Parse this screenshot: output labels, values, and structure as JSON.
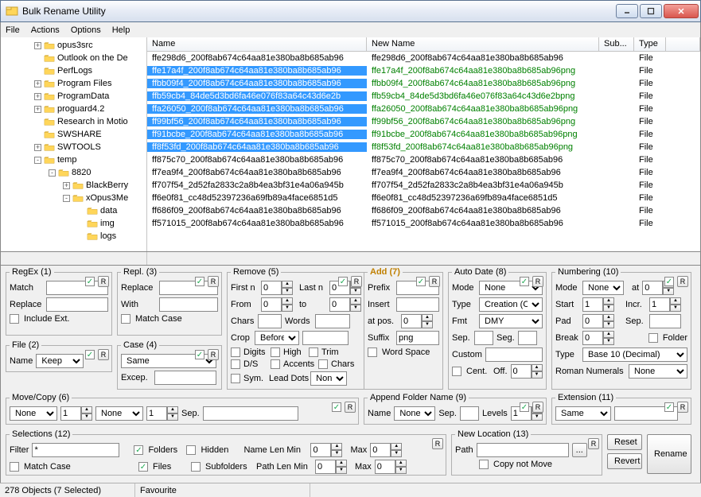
{
  "window": {
    "title": "Bulk Rename Utility"
  },
  "menu": {
    "file": "File",
    "actions": "Actions",
    "options": "Options",
    "help": "Help"
  },
  "tree": [
    {
      "indent": 42,
      "pm": "+",
      "label": "opus3src"
    },
    {
      "indent": 42,
      "pm": "",
      "label": "Outlook on the De"
    },
    {
      "indent": 42,
      "pm": "",
      "label": "PerfLogs"
    },
    {
      "indent": 42,
      "pm": "+",
      "label": "Program Files"
    },
    {
      "indent": 42,
      "pm": "+",
      "label": "ProgramData"
    },
    {
      "indent": 42,
      "pm": "+",
      "label": "proguard4.2"
    },
    {
      "indent": 42,
      "pm": "",
      "label": "Research in Motio"
    },
    {
      "indent": 42,
      "pm": "",
      "label": "SWSHARE"
    },
    {
      "indent": 42,
      "pm": "+",
      "label": "SWTOOLS"
    },
    {
      "indent": 42,
      "pm": "-",
      "label": "temp"
    },
    {
      "indent": 60,
      "pm": "-",
      "label": "8820"
    },
    {
      "indent": 78,
      "pm": "+",
      "label": "BlackBerry"
    },
    {
      "indent": 78,
      "pm": "-",
      "label": "xOpus3Me"
    },
    {
      "indent": 96,
      "pm": "",
      "label": "data"
    },
    {
      "indent": 96,
      "pm": "",
      "label": "img"
    },
    {
      "indent": 96,
      "pm": "",
      "label": "logs"
    }
  ],
  "columns": {
    "name": "Name",
    "newname": "New Name",
    "sub": "Sub...",
    "type": "Type"
  },
  "files": [
    {
      "sel": false,
      "name": "ffe298d6_200f8ab674c64aa81e380ba8b685ab96",
      "newname": "ffe298d6_200f8ab674c64aa81e380ba8b685ab96",
      "green": false,
      "type": "File"
    },
    {
      "sel": true,
      "name": "ffe17a4f_200f8ab674c64aa81e380ba8b685ab96",
      "newname": "ffe17a4f_200f8ab674c64aa81e380ba8b685ab96png",
      "green": true,
      "type": "File"
    },
    {
      "sel": true,
      "name": "ffbb09f4_200f8ab674c64aa81e380ba8b685ab96",
      "newname": "ffbb09f4_200f8ab674c64aa81e380ba8b685ab96png",
      "green": true,
      "type": "File"
    },
    {
      "sel": true,
      "name": "ffb59cb4_84de5d3bd6fa46e076f83a64c43d6e2b",
      "newname": "ffb59cb4_84de5d3bd6fa46e076f83a64c43d6e2bpng",
      "green": true,
      "type": "File"
    },
    {
      "sel": true,
      "name": "ffa26050_200f8ab674c64aa81e380ba8b685ab96",
      "newname": "ffa26050_200f8ab674c64aa81e380ba8b685ab96png",
      "green": true,
      "type": "File"
    },
    {
      "sel": true,
      "name": "ff99bf56_200f8ab674c64aa81e380ba8b685ab96",
      "newname": "ff99bf56_200f8ab674c64aa81e380ba8b685ab96png",
      "green": true,
      "type": "File"
    },
    {
      "sel": true,
      "name": "ff91bcbe_200f8ab674c64aa81e380ba8b685ab96",
      "newname": "ff91bcbe_200f8ab674c64aa81e380ba8b685ab96png",
      "green": true,
      "type": "File"
    },
    {
      "sel": true,
      "name": "ff8f53fd_200f8ab674c64aa81e380ba8b685ab96",
      "newname": "ff8f53fd_200f8ab674c64aa81e380ba8b685ab96png",
      "green": true,
      "type": "File"
    },
    {
      "sel": false,
      "name": "ff875c70_200f8ab674c64aa81e380ba8b685ab96",
      "newname": "ff875c70_200f8ab674c64aa81e380ba8b685ab96",
      "green": false,
      "type": "File"
    },
    {
      "sel": false,
      "name": "ff7ea9f4_200f8ab674c64aa81e380ba8b685ab96",
      "newname": "ff7ea9f4_200f8ab674c64aa81e380ba8b685ab96",
      "green": false,
      "type": "File"
    },
    {
      "sel": false,
      "name": "ff707f54_2d52fa2833c2a8b4ea3bf31e4a06a945b",
      "newname": "ff707f54_2d52fa2833c2a8b4ea3bf31e4a06a945b",
      "green": false,
      "type": "File"
    },
    {
      "sel": false,
      "name": "ff6e0f81_cc48d52397236a69fb89a4face6851d5",
      "newname": "ff6e0f81_cc48d52397236a69fb89a4face6851d5",
      "green": false,
      "type": "File"
    },
    {
      "sel": false,
      "name": "ff686f09_200f8ab674c64aa81e380ba8b685ab96",
      "newname": "ff686f09_200f8ab674c64aa81e380ba8b685ab96",
      "green": false,
      "type": "File"
    },
    {
      "sel": false,
      "name": "ff571015_200f8ab674c64aa81e380ba8b685ab96",
      "newname": "ff571015_200f8ab674c64aa81e380ba8b685ab96",
      "green": false,
      "type": "File"
    }
  ],
  "regex": {
    "legend": "RegEx (1)",
    "match": "Match",
    "replace": "Replace",
    "include": "Include Ext."
  },
  "repl": {
    "legend": "Repl. (3)",
    "replace": "Replace",
    "with": "With",
    "matchcase": "Match Case"
  },
  "file": {
    "legend": "File (2)",
    "name": "Name",
    "keep": "Keep"
  },
  "case": {
    "legend": "Case (4)",
    "same": "Same",
    "excep": "Excep."
  },
  "remove": {
    "legend": "Remove (5)",
    "firstn": "First n",
    "lastn": "Last n",
    "from": "From",
    "to": "to",
    "chars": "Chars",
    "words": "Words",
    "crop": "Crop",
    "before": "Before",
    "digits": "Digits",
    "high": "High",
    "trim": "Trim",
    "ds": "D/S",
    "accents": "Accents",
    "chars2": "Chars",
    "sym": "Sym.",
    "lead": "Lead Dots",
    "non": "Non"
  },
  "add": {
    "legend": "Add (7)",
    "prefix": "Prefix",
    "insert": "Insert",
    "atpos": "at pos.",
    "suffix": "Suffix",
    "suffixval": "png",
    "wordspace": "Word Space"
  },
  "autodate": {
    "legend": "Auto Date (8)",
    "mode": "Mode",
    "none": "None",
    "type": "Type",
    "creation": "Creation (Cur",
    "fmt": "Fmt",
    "dmy": "DMY",
    "sep": "Sep.",
    "seg": "Seg.",
    "custom": "Custom",
    "cent": "Cent.",
    "off": "Off."
  },
  "numbering": {
    "legend": "Numbering (10)",
    "mode": "Mode",
    "none": "None",
    "at": "at",
    "start": "Start",
    "incr": "Incr.",
    "pad": "Pad",
    "sep": "Sep.",
    "break": "Break",
    "folder": "Folder",
    "type": "Type",
    "base10": "Base 10 (Decimal)",
    "roman": "Roman Numerals",
    "none2": "None"
  },
  "movecopy": {
    "legend": "Move/Copy (6)",
    "none": "None",
    "sep": "Sep."
  },
  "append": {
    "legend": "Append Folder Name (9)",
    "name": "Name",
    "none": "None",
    "sep": "Sep.",
    "levels": "Levels"
  },
  "ext": {
    "legend": "Extension (11)",
    "same": "Same"
  },
  "selections": {
    "legend": "Selections (12)",
    "filter": "Filter",
    "filterval": "*",
    "matchcase": "Match Case",
    "folders": "Folders",
    "hidden": "Hidden",
    "files": "Files",
    "subfolders": "Subfolders",
    "namelenmin": "Name Len Min",
    "pathlenmin": "Path Len Min",
    "max": "Max"
  },
  "newloc": {
    "legend": "New Location (13)",
    "path": "Path",
    "copy": "Copy not Move",
    "browse": "..."
  },
  "buttons": {
    "reset": "Reset",
    "revert": "Revert",
    "rename": "Rename"
  },
  "r_label": "R",
  "zeros": {
    "z": "0",
    "one": "1"
  },
  "status": {
    "left": "278 Objects (7 Selected)",
    "fav": "Favourite"
  }
}
